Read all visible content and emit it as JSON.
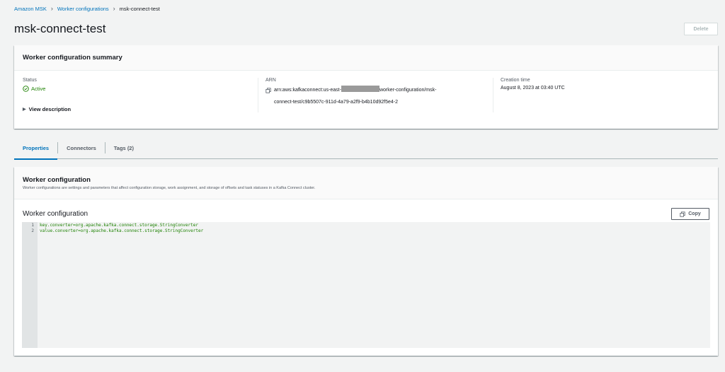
{
  "breadcrumb": {
    "items": [
      "Amazon MSK",
      "Worker configurations",
      "msk-connect-test"
    ]
  },
  "page": {
    "title": "msk-connect-test",
    "delete_label": "Delete"
  },
  "summary": {
    "title": "Worker configuration summary",
    "status_label": "Status",
    "status_value": "Active",
    "view_description": "View description",
    "arn_label": "ARN",
    "arn_prefix": "arn:aws:kafkaconnect:us-east-",
    "arn_suffix_1": "worker-configuration/msk-",
    "arn_suffix_2": "connect-test/c9b5507c-911d-4a79-a2f9-b4b10d92f5e4-2",
    "creation_label": "Creation time",
    "creation_value": "August 8, 2023 at 03:40 UTC"
  },
  "tabs": [
    {
      "label": "Properties",
      "active": true
    },
    {
      "label": "Connectors",
      "active": false
    },
    {
      "label": "Tags (2)",
      "active": false
    }
  ],
  "config": {
    "title": "Worker configuration",
    "description": "Worker configurations are settings and parameters that affect configuration storage, work assignment, and storage of offsets and task statuses in a Kafka Connect cluster.",
    "subtitle": "Worker configuration",
    "copy_label": "Copy",
    "lines": [
      {
        "num": "1",
        "text": "key.converter=org.apache.kafka.connect.storage.StringConverter"
      },
      {
        "num": "2",
        "text": "value.converter=org.apache.kafka.connect.storage.StringConverter"
      }
    ]
  },
  "colors": {
    "link": "#0073bb",
    "success": "#1d8102",
    "background": "#f2f3f3"
  }
}
